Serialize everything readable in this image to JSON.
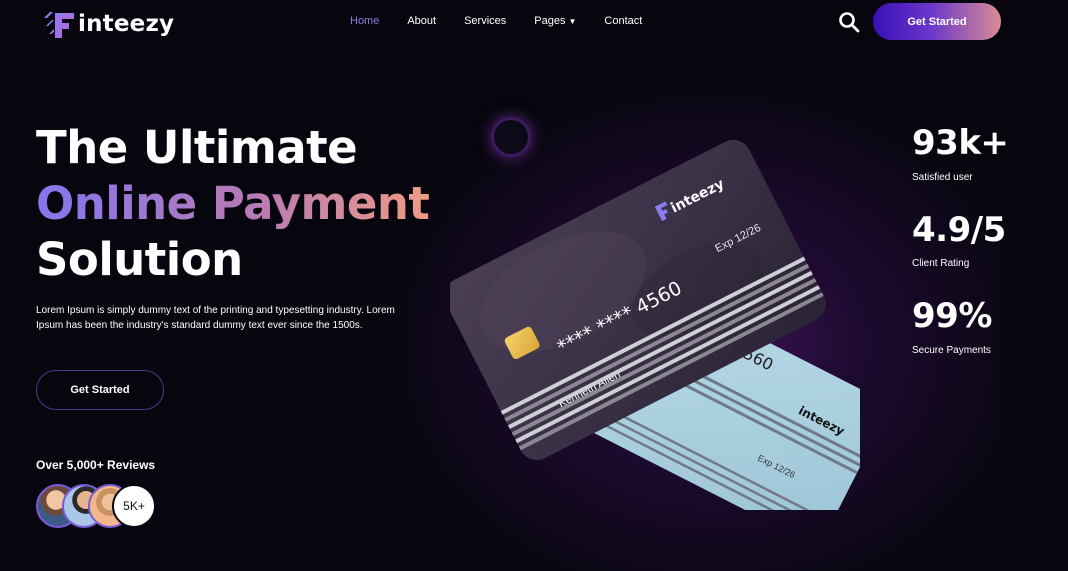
{
  "brand": {
    "name": "inteezy",
    "colors": {
      "accent": "#8b7de6",
      "gradient_start": "#3a0fb8",
      "gradient_end": "#d98c93",
      "background": "#07060e"
    }
  },
  "nav": {
    "items": [
      {
        "label": "Home",
        "active": true
      },
      {
        "label": "About"
      },
      {
        "label": "Services"
      },
      {
        "label": "Pages",
        "caret": "▼"
      },
      {
        "label": "Contact"
      }
    ],
    "search_icon": "search-icon",
    "cta_label": "Get Started"
  },
  "hero": {
    "title_line1": "The Ultimate",
    "title_line2": "Online Payment",
    "title_line3": "Solution",
    "description": "Lorem Ipsum is simply dummy text of the printing and typesetting industry. Lorem Ipsum has been the industry's standard dummy text ever since the 1500s.",
    "cta_label": "Get Started",
    "reviews_label": "Over 5,000+ Reviews",
    "reviews_count_badge": "5K+"
  },
  "card_front": {
    "brand": "inteezy",
    "number": "**** **** 4560",
    "expiry": "Exp 12/26",
    "holder": "Kenneth Allen"
  },
  "card_back": {
    "brand": "inteezy",
    "number": "4560",
    "expiry": "Exp 12/26"
  },
  "stats": [
    {
      "value": "93k+",
      "label": "Satisfied user"
    },
    {
      "value": "4.9/5",
      "label": "Client Rating"
    },
    {
      "value": "99%",
      "label": "Secure Payments"
    }
  ]
}
